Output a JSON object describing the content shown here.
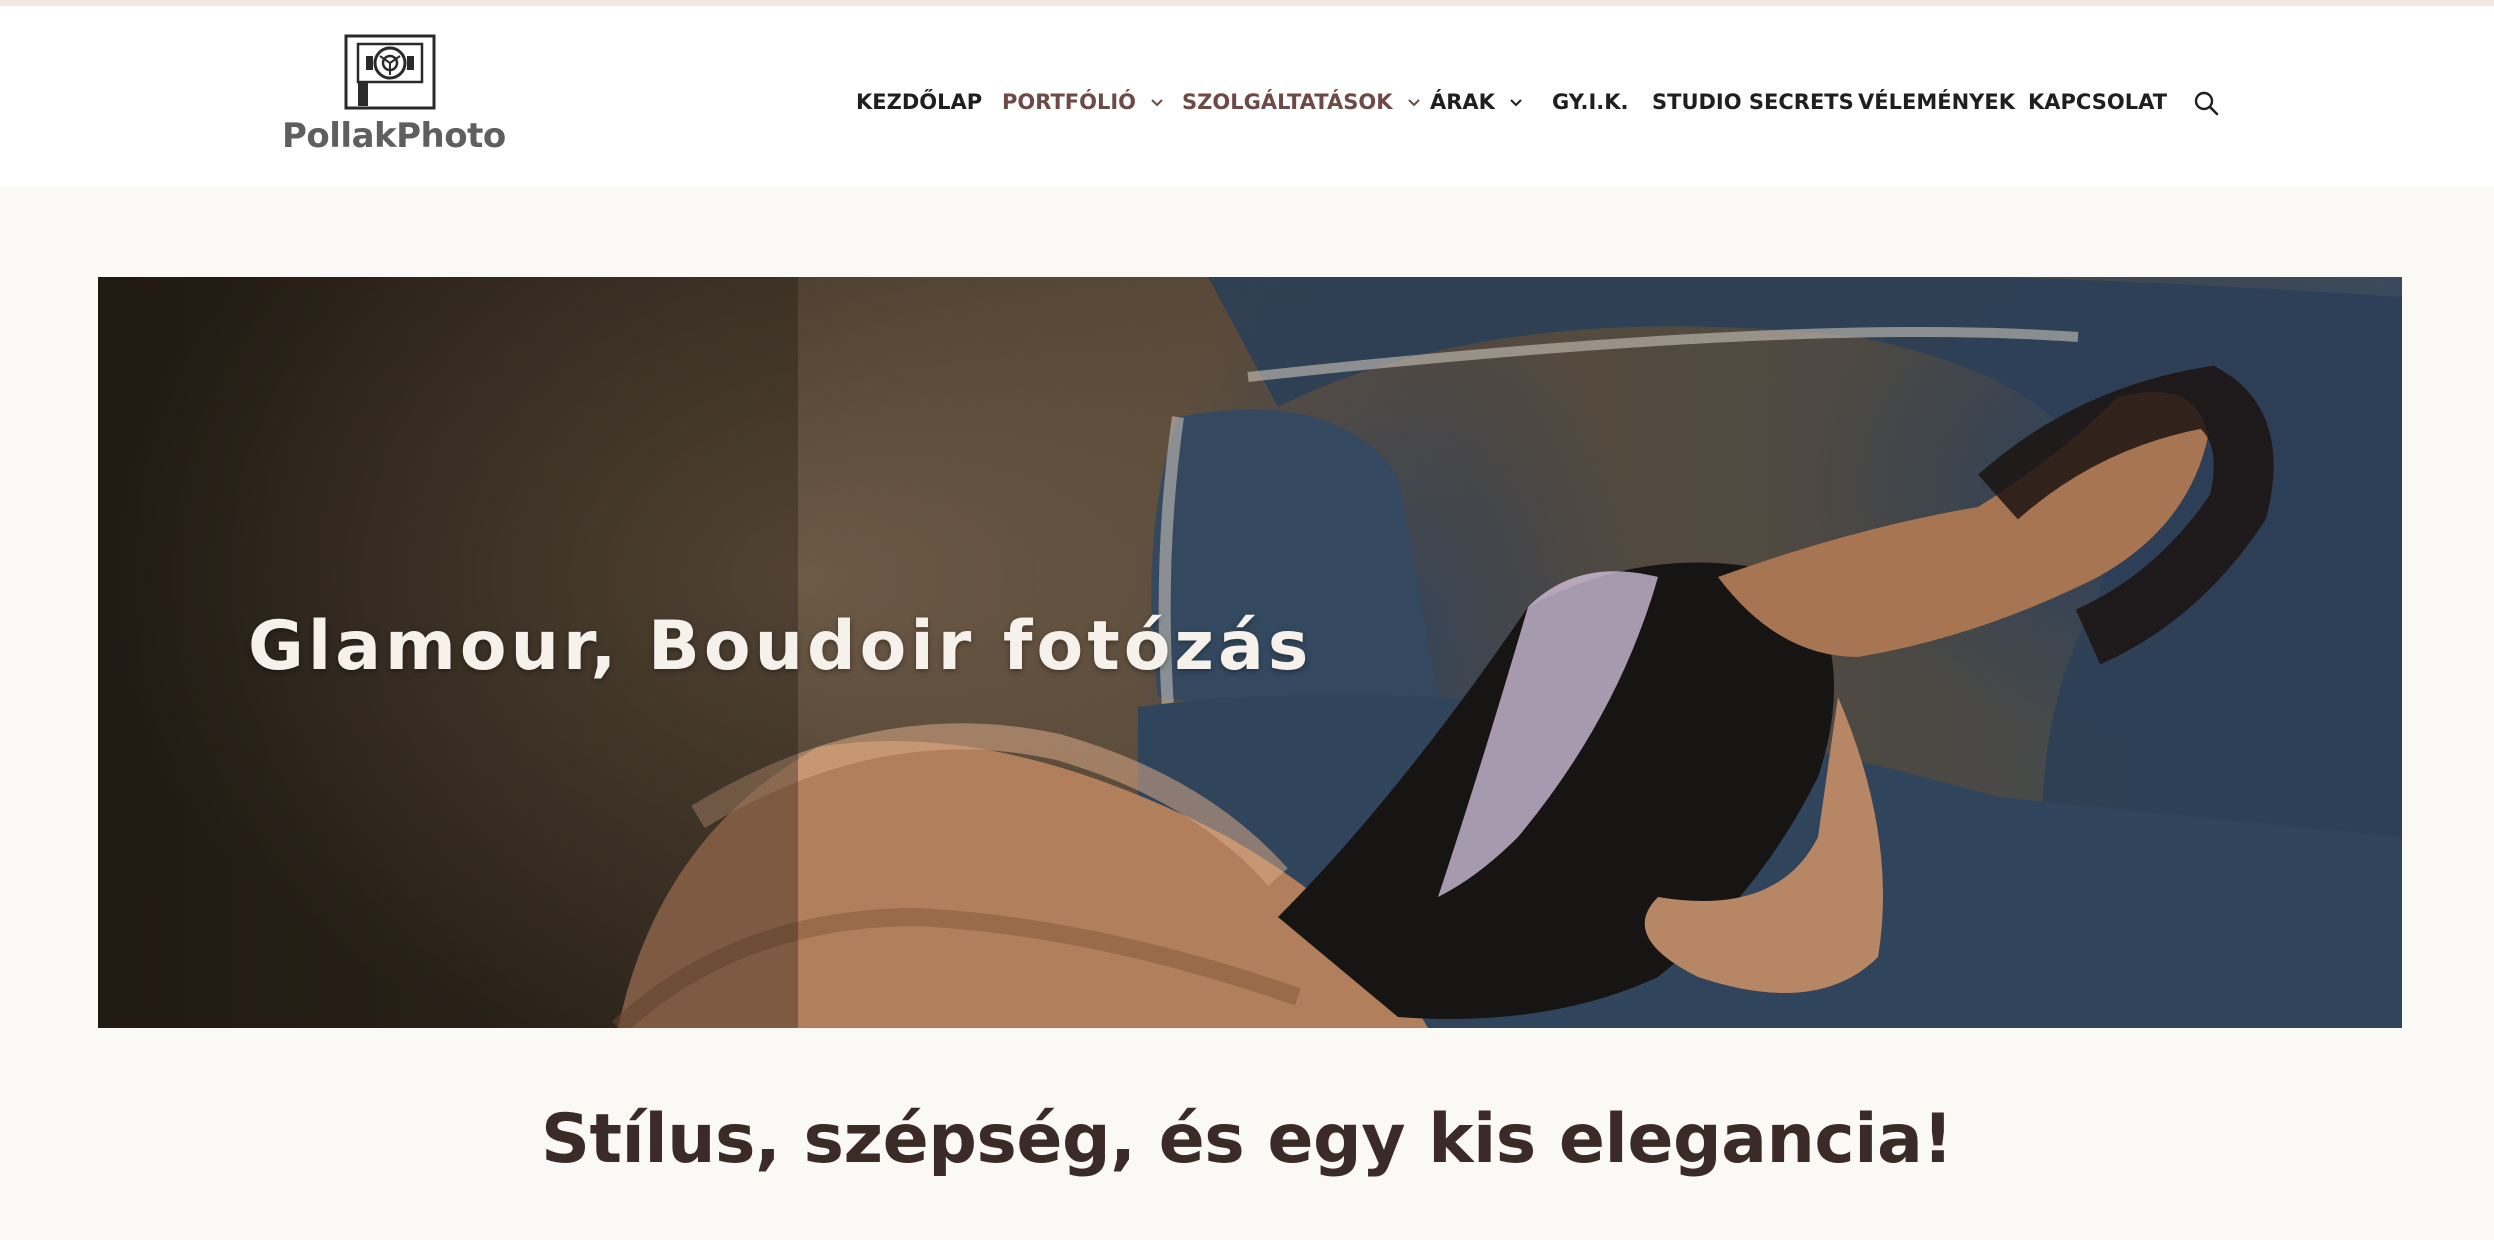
{
  "brand": {
    "name": "PollakPhoto"
  },
  "nav": {
    "items": [
      {
        "label": "KEZDŐLAP",
        "has_dropdown": false
      },
      {
        "label": "PORTFÓLIÓ",
        "has_dropdown": true
      },
      {
        "label": "SZOLGÁLTATÁSOK",
        "has_dropdown": true
      },
      {
        "label": "ÁRAK",
        "has_dropdown": true
      },
      {
        "label": "GY.I.K.",
        "has_dropdown": false
      },
      {
        "label": "STUDIO SECRETS",
        "has_dropdown": false
      },
      {
        "label": "VÉLEMÉNYEK",
        "has_dropdown": false
      },
      {
        "label": "KAPCSOLAT",
        "has_dropdown": false
      }
    ],
    "search_icon": "search-icon",
    "dropdown_icon": "chevron-down-icon"
  },
  "hero": {
    "title": "Glamour, Boudoir fotózás"
  },
  "main": {
    "tagline": "Stílus, szépség, és egy kis elegancia!"
  },
  "colors": {
    "page_background": "#fbf9f6",
    "header_background": "#ffffff",
    "nav_text": "#1f1f1f",
    "nav_accent": "#6d4a47",
    "tagline_text": "#3a2a28",
    "hero_title_text": "#f6f1ea"
  }
}
